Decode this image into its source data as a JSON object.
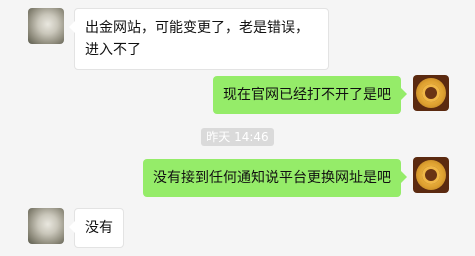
{
  "chat": {
    "messages": [
      {
        "side": "in",
        "text": "出金网站，可能变更了，老是错误，进入不了"
      },
      {
        "side": "out",
        "text": "现在官网已经打不开了是吧"
      },
      {
        "side": "out",
        "text": "没有接到任何通知说平台更换网址是吧"
      },
      {
        "side": "in",
        "text": "没有"
      }
    ],
    "timestamp": "昨天 14:46"
  },
  "avatars": {
    "contact_icon": "contact-photo-avatar",
    "self_icon": "golden-lion-logo-avatar"
  },
  "colors": {
    "background": "#f5f5f5",
    "incoming_bubble": "#ffffff",
    "outgoing_bubble": "#95ec69",
    "timestamp_pill": "#dadada"
  }
}
